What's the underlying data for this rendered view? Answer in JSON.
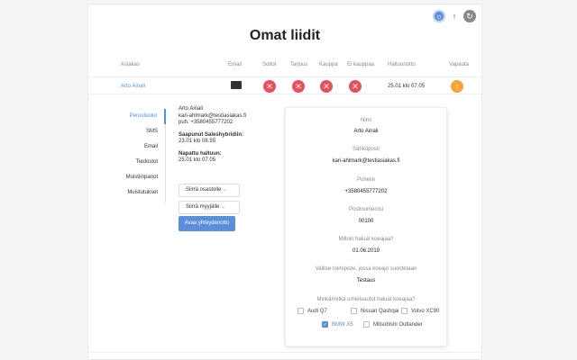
{
  "header": {
    "title": "Omat liidit",
    "icons": [
      "chat-icon",
      "arrow-up-icon",
      "refresh-icon"
    ]
  },
  "table": {
    "columns": [
      "Asiakas",
      "Email",
      "Soitot",
      "Tarjous",
      "Kauppa",
      "Ei kauppaa",
      "Haltuunotto",
      "Vapauta"
    ],
    "row": {
      "customer": "Arto Ainali",
      "date": "25.01 klo 07.05"
    }
  },
  "tabs": [
    "Perustiedot",
    "SMS",
    "Email",
    "Tiedostot",
    "Muistiinpanot",
    "Muistutukset"
  ],
  "details": {
    "name": "Arto Ainali",
    "email": "kari-ahlmark@testiasiakas.fi",
    "phone": "puh. +3580455777202",
    "arrived_label": "Saapunut Saleshybridiin:",
    "arrived_value": "23.01 klo 08.55",
    "taken_label": "Napattu haltuun:",
    "taken_value": "25.01 klo 07.05",
    "move_department": "Siirrä osastolle",
    "move_seller": "Siirrä myyjälle",
    "open_contact": "Avaa yhteydenotto"
  },
  "form": {
    "name_label": "Nimi",
    "name_value": "Arto Ainali",
    "email_label": "Sähköposti",
    "email_value": "kari-ahlmark@testiasiakas.fi",
    "phone_label": "Puhelin",
    "phone_value": "+3580455777202",
    "zip_label": "Postinumerosi",
    "zip_value": "00100",
    "date_label": "Milloin haluat koeajaa?",
    "date_value": "01.06.2019",
    "place_label": "Valitse toimipiste, jossa koeajo suoritetaan",
    "place_value": "Testaus",
    "cars_label": "Minkä/mitkä urheiluautot haluat koeajaa?",
    "cars": [
      {
        "label": "Audi Q7",
        "checked": false
      },
      {
        "label": "Nissan Qashqai",
        "checked": false
      },
      {
        "label": "Volvo XC90",
        "checked": false
      },
      {
        "label": "BMW X5",
        "checked": true
      },
      {
        "label": "Mitsubishi Outlander",
        "checked": false
      }
    ]
  },
  "colors": {
    "accent": "#5b8fd9",
    "danger": "#e8505b",
    "warning": "#f5a43a"
  }
}
